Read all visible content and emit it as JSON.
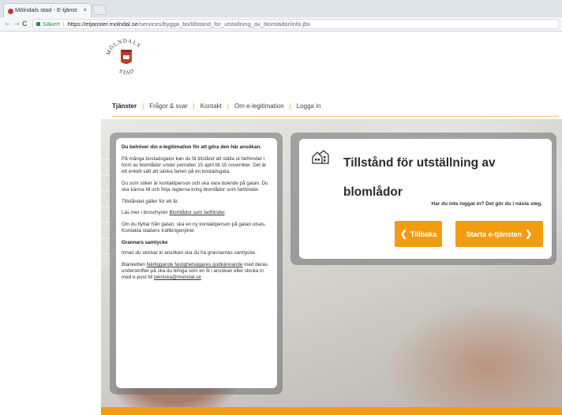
{
  "browser": {
    "tab_title": "Mölndals stad - E-tjänst",
    "tab_close": "×",
    "back": "←",
    "forward": "→",
    "reload": "C",
    "secure_label": "Säkert",
    "separator": "|",
    "url_host": "https://etjanster.molndal.se",
    "url_path": "/services/bygga_bo/tillstand_for_utstallning_av_blomlador/info.jbx"
  },
  "logo": {
    "top_text": "MÖLNDALS",
    "bottom_text": "STAD"
  },
  "nav": {
    "items": [
      "Tjänster",
      "Frågor & svar",
      "Kontakt",
      "Om e-legitimation",
      "Logga in"
    ],
    "divider": "|"
  },
  "info": {
    "intro": "Du behöver din e-legitimation för att göra den här ansökan.",
    "p1": "På många bostadsgator kan du få tillstånd att ställa ut farthinder i form av blomlådor under perioden 15 april till 15 november. Det är ett enkelt sätt att sänka farten på en bostadsgata.",
    "p2": "Du som söker är kontaktperson och ska vara boende på gatan. Du ska känna till och följa reglerna kring blomlådor som farthinder.",
    "p3": "Tillståndet gäller för ett år.",
    "p4_prefix": "Läs mer i broschyren ",
    "p4_link": "Blomlådor som farthinder",
    "p4_suffix": ".",
    "p5": "Om du flyttar från gatan, ska en ny kontaktperson på gatan utses. Kontakta stadens trafikingenjörer.",
    "heading": "Grannars samtycke",
    "p6": "Innan du skickar in ansökan ska du ha grannarnas samtycke.",
    "p7_prefix": "Blanketten ",
    "p7_link": "Närliggande fastighetsägares godkännande",
    "p7_mid": " med deras underskrifter på ska du bifoga som en fil i ansökan eller skicka in med e-post till ",
    "p7_email": "tekniska@molndal.se"
  },
  "permit": {
    "title": "Tillstånd för utställning av blomlådor",
    "question": "Har du inte loggat in? Det gör du i nästa steg.",
    "back_label": "Tillbaka",
    "start_label": "Starta e-tjänsten",
    "back_chevron": "❮",
    "start_chevron": "❯"
  },
  "colors": {
    "accent": "#f39c12",
    "logo_red": "#c0392b",
    "secure_green": "#1e8e3e"
  }
}
